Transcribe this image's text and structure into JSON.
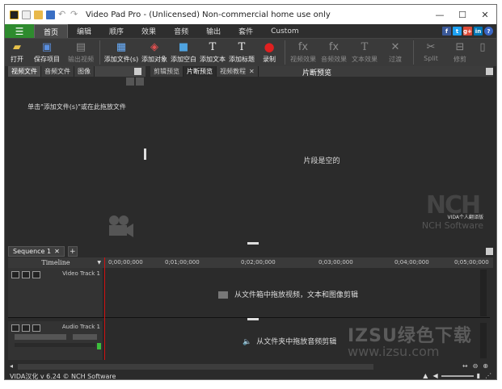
{
  "window": {
    "title": "Video Pad Pro - (Unlicensed) Non-commercial home use only",
    "controls": [
      "—",
      "☐",
      "✕"
    ]
  },
  "menu": {
    "tabs": [
      "首页",
      "编辑",
      "顺序",
      "效果",
      "音频",
      "输出",
      "套件",
      "Custom"
    ],
    "active": "首页"
  },
  "social": [
    {
      "label": "f",
      "color": "#3b5998"
    },
    {
      "label": "t",
      "color": "#1da1f2"
    },
    {
      "label": "g+",
      "color": "#dd4b39"
    },
    {
      "label": "in",
      "color": "#0077b5"
    },
    {
      "label": "?",
      "color": "#3a66c4"
    }
  ],
  "toolbar": {
    "items": [
      {
        "label": "打开",
        "icon": "folder-icon",
        "glyph": "📂",
        "enabled": true
      },
      {
        "label": "保存项目",
        "icon": "save-icon",
        "glyph": "💾",
        "enabled": true
      },
      {
        "label": "输出视频",
        "icon": "export-icon",
        "glyph": "🎞",
        "enabled": false
      },
      {
        "label": "添加文件(s)",
        "icon": "add-file-icon",
        "glyph": "➕",
        "enabled": true
      },
      {
        "label": "添加对象",
        "icon": "add-object-icon",
        "glyph": "🧩",
        "enabled": true
      },
      {
        "label": "添加空白",
        "icon": "add-blank-icon",
        "glyph": "▭",
        "enabled": true
      },
      {
        "label": "添加文本",
        "icon": "add-text-icon",
        "glyph": "T",
        "enabled": true
      },
      {
        "label": "添加标题",
        "icon": "add-title-icon",
        "glyph": "T",
        "enabled": true
      },
      {
        "label": "录制",
        "icon": "record-icon",
        "glyph": "●",
        "enabled": true
      },
      {
        "label": "视频效果",
        "icon": "video-effects-icon",
        "glyph": "fx",
        "enabled": false
      },
      {
        "label": "音频效果",
        "icon": "audio-effects-icon",
        "glyph": "fx",
        "enabled": false
      },
      {
        "label": "文本效果",
        "icon": "text-effects-icon",
        "glyph": "T",
        "enabled": false
      },
      {
        "label": "过渡",
        "icon": "transition-icon",
        "glyph": "✕",
        "enabled": false
      },
      {
        "label": "Split",
        "icon": "split-icon",
        "glyph": "✂",
        "enabled": false
      },
      {
        "label": "修剪",
        "icon": "trim-icon",
        "glyph": "⊟",
        "enabled": false
      },
      {
        "label": "",
        "icon": "more-icon",
        "glyph": "▯",
        "enabled": false
      }
    ]
  },
  "bin": {
    "tabs": [
      "视频文件",
      "音频文件",
      "图像"
    ],
    "active": "视频文件",
    "hint": "单击\"添加文件(s)\"或在此拖放文件"
  },
  "preview": {
    "tabs": [
      "剪辑预览",
      "片断预览",
      "视频教程"
    ],
    "active": "片断预览",
    "title": "片断预览",
    "empty_text": "片段是空的",
    "logo_text": "NCH",
    "logo_cn": "VIDA个人翻译版",
    "logo_sub": "NCH Software"
  },
  "sequence": {
    "tab": "Sequence 1",
    "add": "+",
    "timeline_label": "Timeline",
    "ticks": [
      "0;00;00;000",
      "0;01;00;000",
      "0;02;00;000",
      "0;03;00;000",
      "0;04;00;000",
      "0;05;00;000"
    ],
    "video_track": "Video Track 1",
    "video_hint": "从文件箱中拖放视频，文本和图像剪辑",
    "audio_track": "Audio Track 1",
    "audio_hint": "从文件夹中拖放音频剪辑"
  },
  "status": {
    "text": "VIDA汉化 v 6.24 © NCH Software"
  },
  "watermark": {
    "line1": "IZSU绿色下载",
    "line2": "www.izsu.com"
  }
}
